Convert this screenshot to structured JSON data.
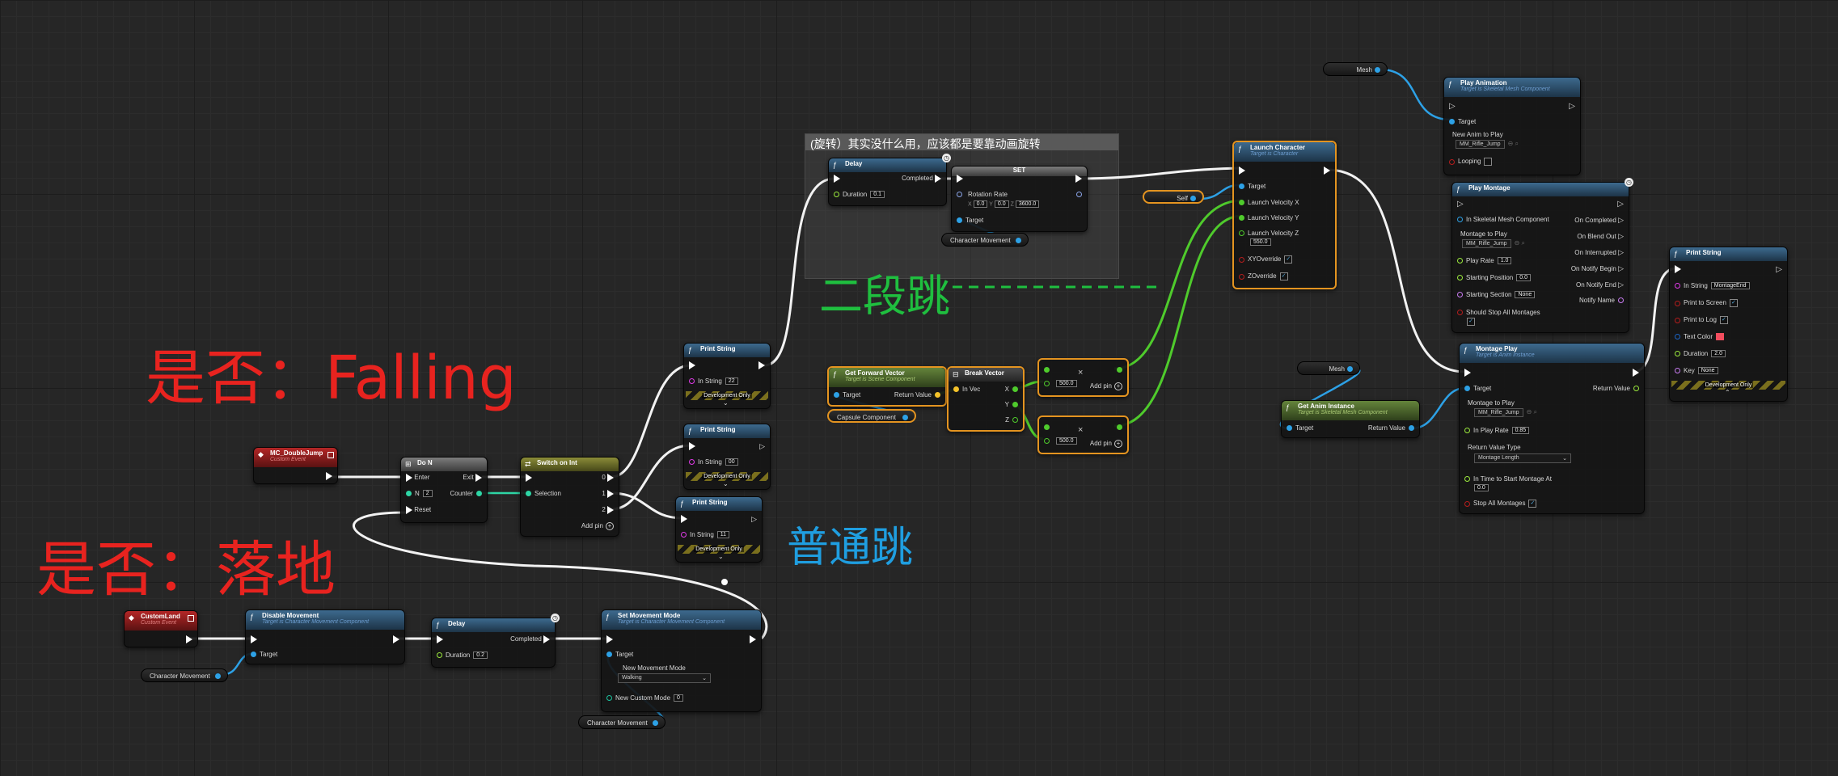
{
  "comment": {
    "title": "(旋转）其实没什么用，应该都是要靠动画旋转"
  },
  "annotations": {
    "falling": "是否：Falling",
    "landed": "是否：落地",
    "double_jump": "二段跳",
    "normal_jump": "普通跳"
  },
  "colors": {
    "annotation_red": "#e8231f",
    "annotation_green": "#1fbf3f",
    "annotation_blue": "#1f9ee0",
    "exec_wire": "#f2f2f2",
    "object_wire": "#2da1e6",
    "vector_wire": "#4fcb2c",
    "int_wire": "#2ed5a5"
  },
  "nodes": {
    "mc_double_jump": {
      "title": "MC_DoubleJump",
      "subtitle": "Custom Event"
    },
    "do_n": {
      "title": "Do N",
      "enter": "Enter",
      "exit": "Exit",
      "n": "N",
      "n_value": "2",
      "counter": "Counter",
      "reset": "Reset"
    },
    "switch_int": {
      "title": "Switch on Int",
      "selection": "Selection",
      "out0": "0",
      "out1": "1",
      "out2": "2",
      "add_pin": "Add pin"
    },
    "print_string_1": {
      "title": "Print String",
      "in_string": "In String",
      "value": "22",
      "dev": "Development Only"
    },
    "print_string_2": {
      "title": "Print String",
      "in_string": "In String",
      "value": "00",
      "dev": "Development Only"
    },
    "print_string_3": {
      "title": "Print String",
      "in_string": "In String",
      "value": "11",
      "dev": "Development Only"
    },
    "delay_top": {
      "title": "Delay",
      "completed": "Completed",
      "duration": "Duration",
      "value": "0.1"
    },
    "set_rotation": {
      "title": "SET",
      "rotation_rate": "Rotation Rate",
      "x": "0.0",
      "y": "0.0",
      "z": "3600.0",
      "target": "Target"
    },
    "char_movement_top": {
      "label": "Character Movement"
    },
    "get_forward_vector": {
      "title": "Get Forward Vector",
      "subtitle": "Target is Scene Component",
      "target": "Target",
      "return_value": "Return Value"
    },
    "capsule_component": {
      "label": "Capsule Component"
    },
    "break_vector": {
      "title": "Break Vector",
      "in_vec": "In Vec",
      "x": "X",
      "y": "Y",
      "z": "Z"
    },
    "multiply_1": {
      "value": "500.0",
      "add_pin": "Add pin"
    },
    "multiply_2": {
      "value": "500.0",
      "add_pin": "Add pin"
    },
    "self_var": {
      "label": "Self"
    },
    "launch_character": {
      "title": "Launch Character",
      "subtitle": "Target is Character",
      "target": "Target",
      "vx": "Launch Velocity X",
      "vy": "Launch Velocity Y",
      "vz": "Launch Velocity Z",
      "vz_value": "550.0",
      "xy_override": "XYOverride",
      "z_override": "ZOverride"
    },
    "mesh_top": {
      "label": "Mesh"
    },
    "play_animation": {
      "title": "Play Animation",
      "subtitle": "Target is Skeletal Mesh Component",
      "target": "Target",
      "new_anim": "New Anim to Play",
      "anim_value": "MM_Rifle_Jump",
      "looping": "Looping"
    },
    "play_montage": {
      "title": "Play Montage",
      "skel_mesh": "In Skeletal Mesh Component",
      "montage": "Montage to Play",
      "montage_value": "MM_Rifle_Jump",
      "play_rate": "Play Rate",
      "play_rate_value": "1.0",
      "starting_position": "Starting Position",
      "starting_position_value": "0.0",
      "starting_section": "Starting Section",
      "starting_section_value": "None",
      "stop_all": "Should Stop All Montages",
      "on_completed": "On Completed",
      "on_blend_out": "On Blend Out",
      "on_interrupted": "On Interrupted",
      "on_notify_begin": "On Notify Begin",
      "on_notify_end": "On Notify End",
      "notify_name": "Notify Name"
    },
    "print_string_right": {
      "title": "Print String",
      "in_string": "In String",
      "value": "MontageEnd",
      "print_to_screen": "Print to Screen",
      "print_to_log": "Print to Log",
      "text_color": "Text Color",
      "duration": "Duration",
      "duration_value": "2.0",
      "key": "Key",
      "key_value": "None",
      "dev": "Development Only"
    },
    "mesh_mid": {
      "label": "Mesh"
    },
    "get_anim_instance": {
      "title": "Get Anim Instance",
      "subtitle": "Target is Skeletal Mesh Component",
      "target": "Target",
      "return_value": "Return Value"
    },
    "montage_play": {
      "title": "Montage Play",
      "subtitle": "Target is Anim Instance",
      "target": "Target",
      "return_value": "Return Value",
      "montage": "Montage to Play",
      "montage_value": "MM_Rifle_Jump",
      "in_play_rate": "In Play Rate",
      "in_play_rate_value": "0.85",
      "return_type": "Return Value Type",
      "return_type_value": "Montage Length",
      "in_time": "In Time to Start Montage At",
      "in_time_value": "0.0",
      "stop_all": "Stop All Montages"
    },
    "custom_land": {
      "title": "CustomLand",
      "subtitle": "Custom Event"
    },
    "disable_movement": {
      "title": "Disable Movement",
      "subtitle": "Target is Character Movement Component",
      "target": "Target"
    },
    "char_movement_bl": {
      "label": "Character Movement"
    },
    "delay_bottom": {
      "title": "Delay",
      "completed": "Completed",
      "duration": "Duration",
      "value": "0.2"
    },
    "set_movement_mode": {
      "title": "Set Movement Mode",
      "subtitle": "Target is Character Movement Component",
      "target": "Target",
      "new_mode": "New Movement Mode",
      "mode_value": "Walking",
      "custom_mode": "New Custom Mode",
      "custom_value": "0"
    },
    "char_movement_bottom": {
      "label": "Character Movement"
    }
  }
}
